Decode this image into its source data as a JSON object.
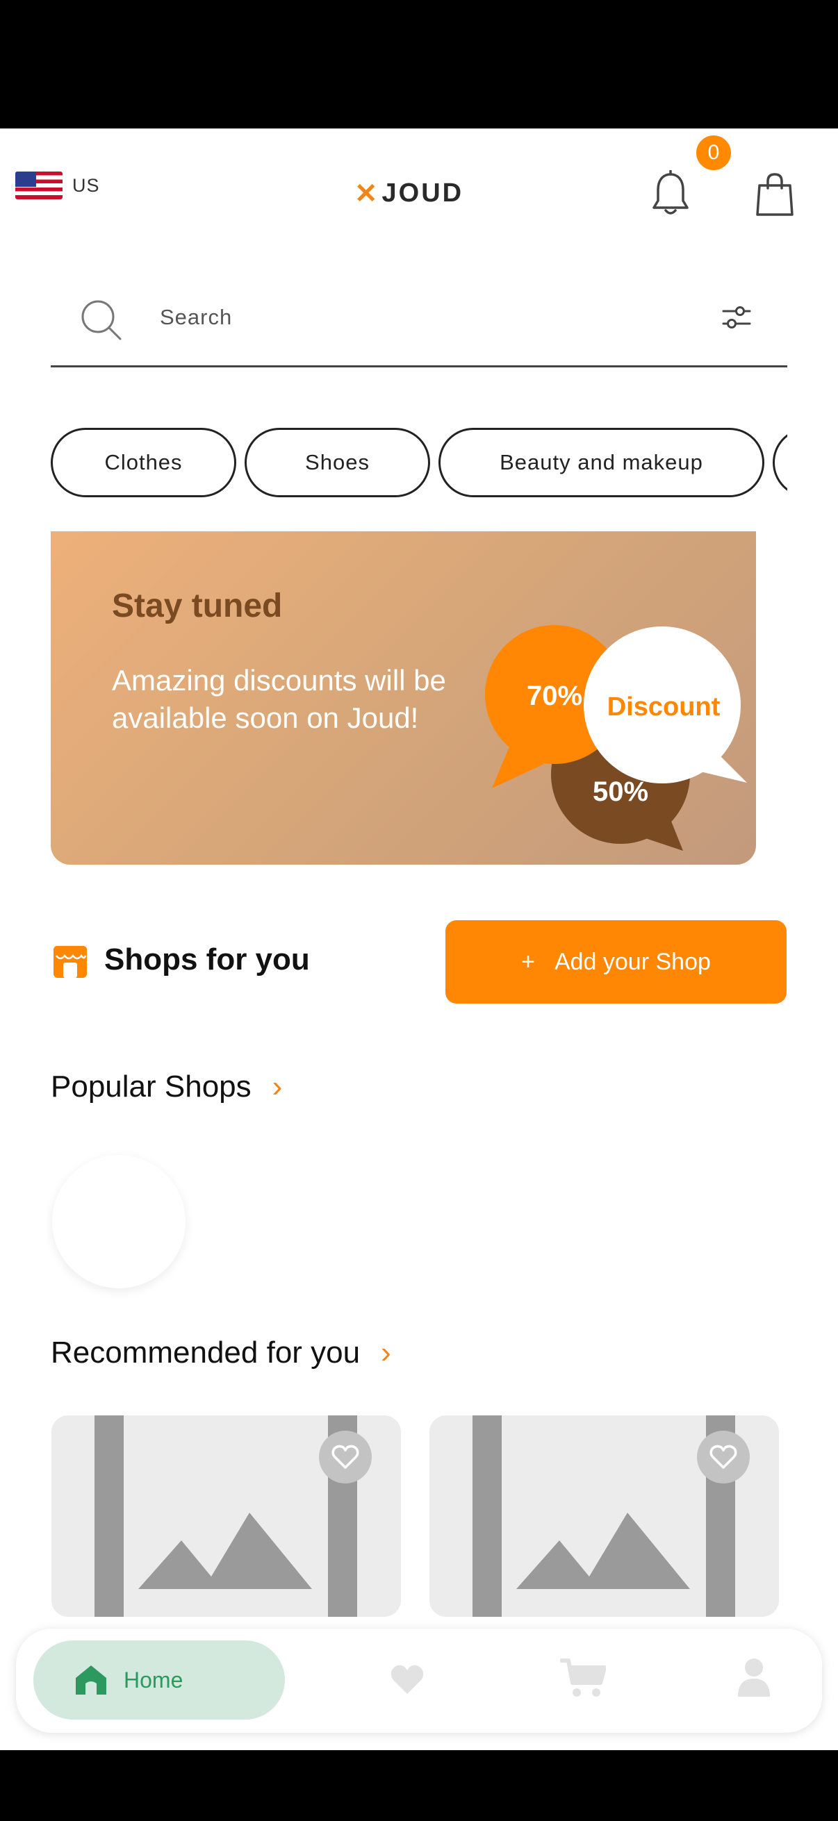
{
  "header": {
    "locale": "US",
    "logo_text": "JOUD",
    "cart_count": "0"
  },
  "search": {
    "placeholder": "Search"
  },
  "categories": [
    "Clothes",
    "Shoes",
    "Beauty and makeup"
  ],
  "banner": {
    "title": "Stay tuned",
    "text": "Amazing discounts will be available soon on Joud!",
    "bubble_orange": "70%",
    "bubble_white": "Discount",
    "bubble_brown": "50%"
  },
  "shops": {
    "title": "Shops for you",
    "add_button_icon": "+",
    "add_button_label": "Add your Shop"
  },
  "popular": {
    "title": "Popular Shops",
    "chevron": "›"
  },
  "recommended": {
    "title": "Recommended for you",
    "chevron": "›"
  },
  "nav": {
    "home": "Home"
  },
  "colors": {
    "accent": "#ff8703",
    "brand_brown": "#7a4a22",
    "active_green": "#2c9a5e",
    "active_pill": "#d3e9dd"
  },
  "icons": [
    "us-flag-icon",
    "bell-icon",
    "shopping-bag-icon",
    "search-icon",
    "filter-icon",
    "store-icon",
    "chevron-right-icon",
    "heart-icon",
    "home-icon",
    "cart-icon",
    "profile-icon"
  ]
}
